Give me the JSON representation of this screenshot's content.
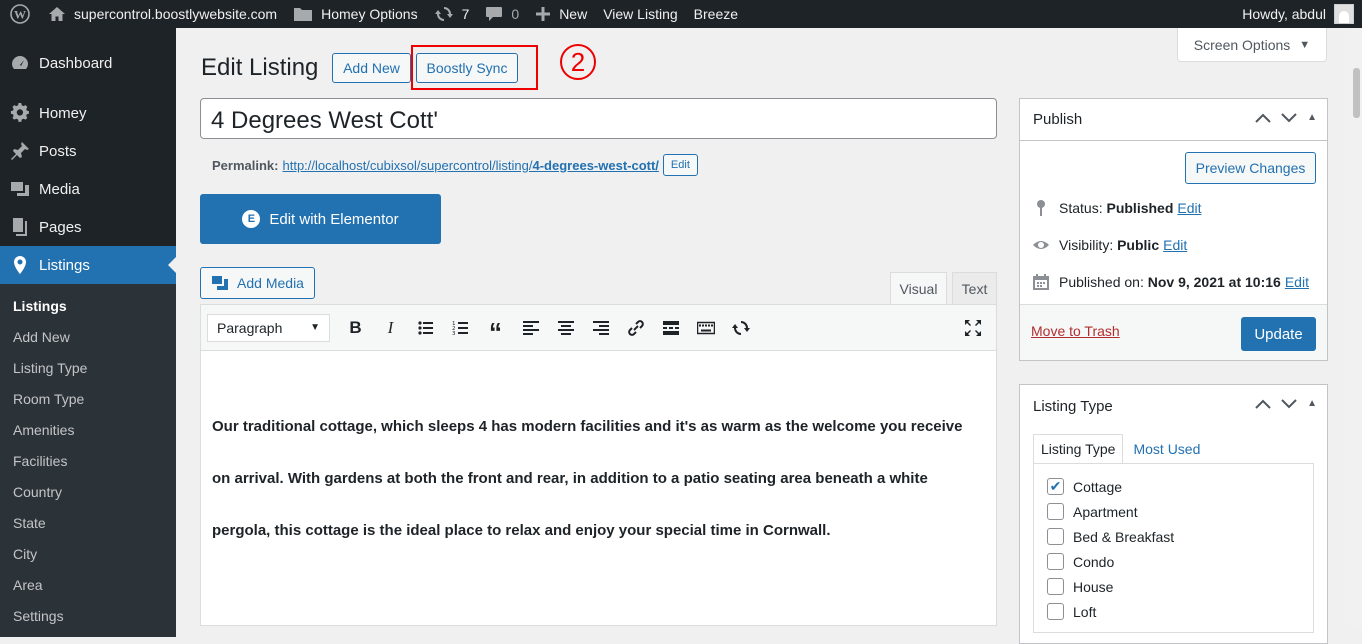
{
  "adminbar": {
    "site": "supercontrol.boostlywebsite.com",
    "homey_options": "Homey Options",
    "updates_count": "7",
    "comments_count": "0",
    "new": "New",
    "view_listing": "View Listing",
    "breeze": "Breeze",
    "howdy": "Howdy, abdul"
  },
  "sidebar": {
    "items": [
      {
        "label": "Dashboard",
        "icon": "dashboard-icon"
      },
      {
        "label": "Homey",
        "icon": "gear-icon"
      },
      {
        "label": "Posts",
        "icon": "pin-icon"
      },
      {
        "label": "Media",
        "icon": "media-icon"
      },
      {
        "label": "Pages",
        "icon": "pages-icon"
      },
      {
        "label": "Listings",
        "icon": "location-icon"
      }
    ],
    "submenu": [
      "Listings",
      "Add New",
      "Listing Type",
      "Room Type",
      "Amenities",
      "Facilities",
      "Country",
      "State",
      "City",
      "Area",
      "Settings"
    ]
  },
  "header": {
    "title": "Edit Listing",
    "add_new": "Add New",
    "boostly_sync": "Boostly Sync",
    "annotation": "2",
    "screen_options": "Screen Options"
  },
  "post": {
    "title": "4 Degrees West Cott'",
    "permalink_label": "Permalink:",
    "permalink_base": "http://localhost/cubixsol/supercontrol/listing/",
    "permalink_slug": "4-degrees-west-cott/",
    "edit_slug": "Edit",
    "elementor_button": "Edit with Elementor",
    "add_media": "Add Media",
    "tab_visual": "Visual",
    "tab_text": "Text",
    "format_select": "Paragraph",
    "content_lines": [
      "Our traditional cottage, which sleeps 4 has modern facilities and it's as warm as the welcome you receive",
      "on arrival. With gardens at both the front and rear, in addition to a patio seating area beneath a white",
      "pergola, this cottage is the ideal place to relax and enjoy your special time in Cornwall."
    ]
  },
  "publish": {
    "title": "Publish",
    "preview": "Preview Changes",
    "status_label": "Status:",
    "status_value": "Published",
    "visibility_label": "Visibility:",
    "visibility_value": "Public",
    "published_label": "Published on:",
    "published_value": "Nov 9, 2021 at 10:16",
    "edit": "Edit",
    "trash": "Move to Trash",
    "update": "Update"
  },
  "listing_type": {
    "title": "Listing Type",
    "tab_all": "Listing Type",
    "tab_used": "Most Used",
    "options": [
      {
        "label": "Cottage",
        "checked": true
      },
      {
        "label": "Apartment",
        "checked": false
      },
      {
        "label": "Bed & Breakfast",
        "checked": false
      },
      {
        "label": "Condo",
        "checked": false
      },
      {
        "label": "House",
        "checked": false
      },
      {
        "label": "Loft",
        "checked": false
      }
    ]
  }
}
